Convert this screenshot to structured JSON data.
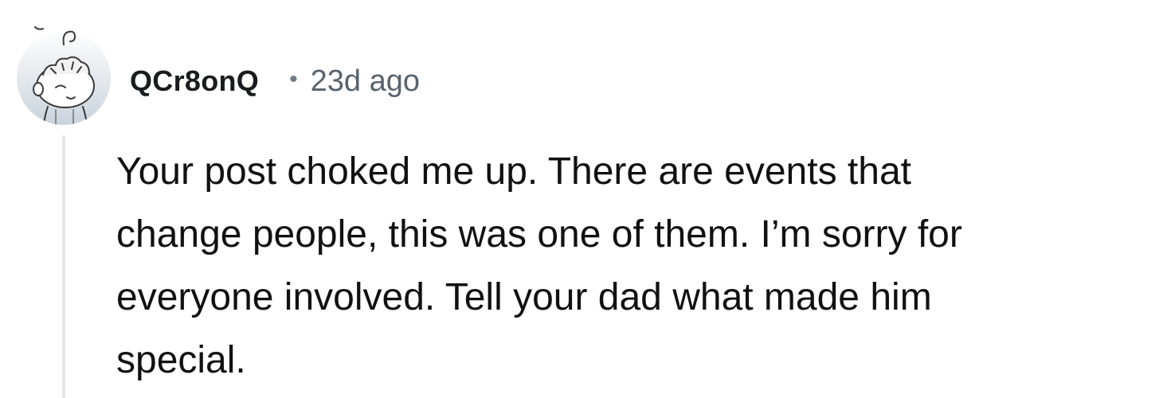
{
  "comment": {
    "author": "QCr8onQ",
    "separator": "•",
    "timestamp": "23d ago",
    "avatar_icon": "snoo-avatar-icon",
    "body_lines": [
      "Your post choked me up. There are events that",
      "change people, this was one of them. I’m sorry for",
      "everyone involved. Tell your dad what made him",
      "special."
    ]
  },
  "colors": {
    "username": "#1a1d1f",
    "timestamp": "#58636e",
    "body": "#111111",
    "thread_line": "#e6e8ea"
  }
}
